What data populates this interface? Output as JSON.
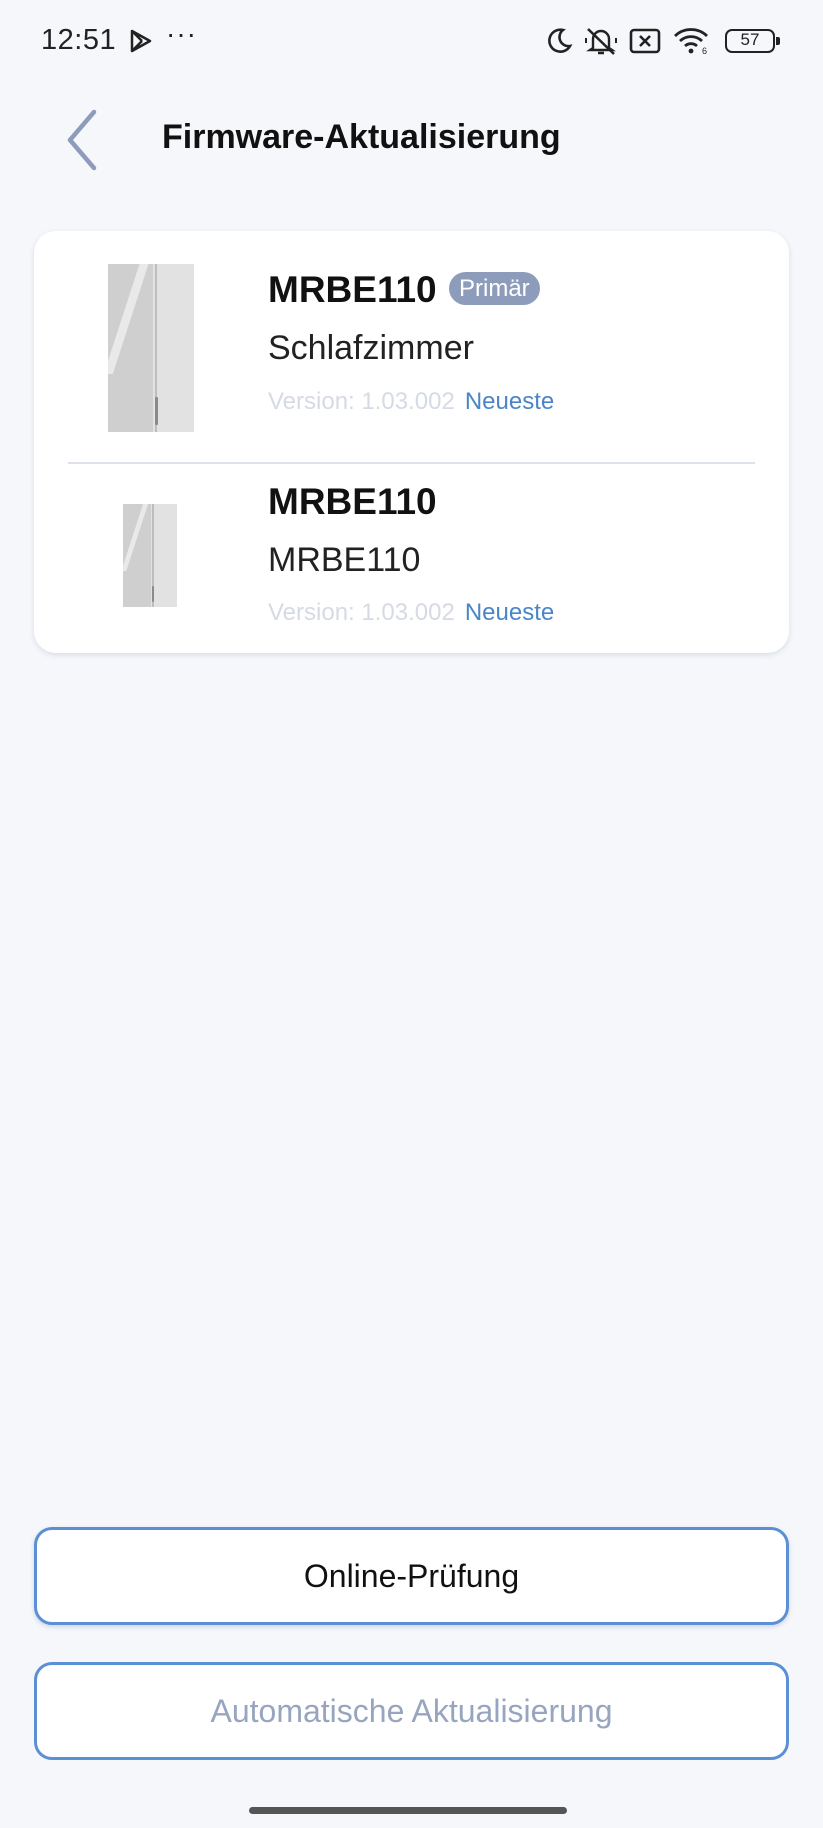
{
  "status_bar": {
    "time": "12:51",
    "dots": "···",
    "battery_level": "57",
    "icons": [
      "play-store-icon",
      "moon-icon",
      "mute-icon",
      "no-sim-icon",
      "wifi-icon",
      "battery-icon"
    ]
  },
  "header": {
    "title": "Firmware-Aktualisierung",
    "back_icon": "chevron-left-icon"
  },
  "devices": [
    {
      "model": "MRBE110",
      "badge": "Primär",
      "room": "Schlafzimmer",
      "version": "Version: 1.03.002",
      "status": "Neueste"
    },
    {
      "model": "MRBE110",
      "room": "MRBE110",
      "version": "Version: 1.03.002",
      "status": "Neueste"
    }
  ],
  "buttons": {
    "online_check": "Online-Prüfung",
    "auto_update": "Automatische Aktualisierung"
  },
  "colors": {
    "accent": "#5b8fd6",
    "latest": "#4b85c9",
    "badge": "#8d9cbb",
    "background": "#f5f7fb"
  }
}
